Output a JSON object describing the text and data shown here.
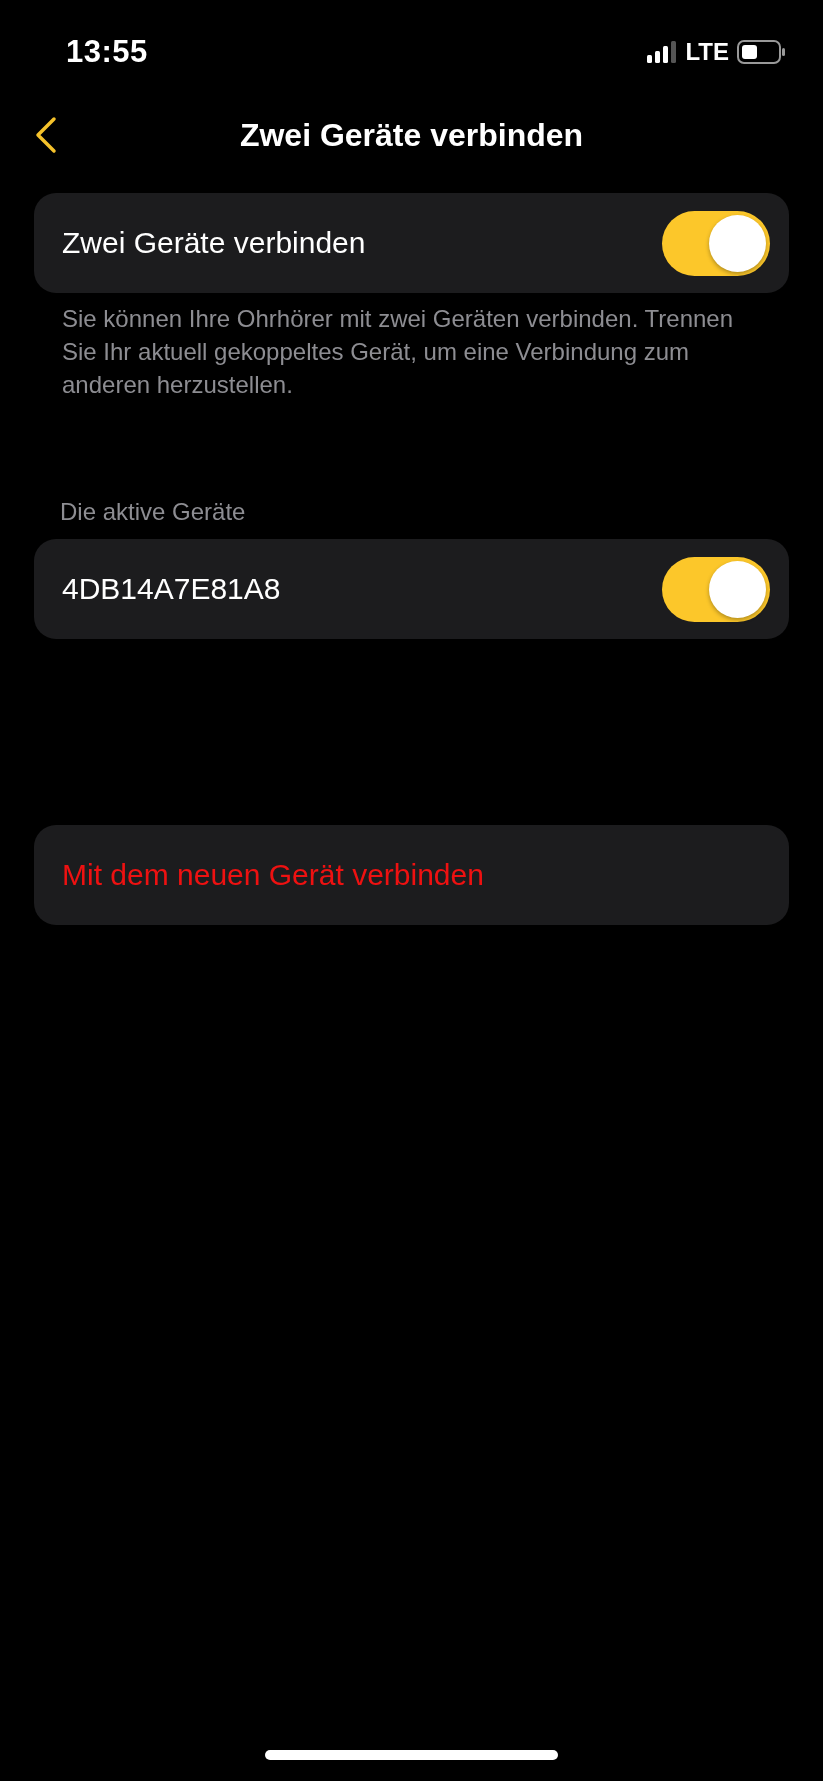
{
  "status_bar": {
    "time": "13:55",
    "network": "LTE"
  },
  "nav": {
    "title": "Zwei Geräte verbinden"
  },
  "main_setting": {
    "label": "Zwei Geräte verbinden",
    "on": true
  },
  "footnote": "Sie können Ihre Ohrhörer mit zwei Geräten verbinden. Trennen Sie Ihr aktuell gekoppeltes Gerät, um eine Verbindung zum anderen herzustellen.",
  "devices_section": {
    "header": "Die aktive Geräte",
    "devices": [
      {
        "name": "4DB14A7E81A8",
        "on": true
      }
    ]
  },
  "action": {
    "label": "Mit dem neuen Gerät verbinden"
  }
}
